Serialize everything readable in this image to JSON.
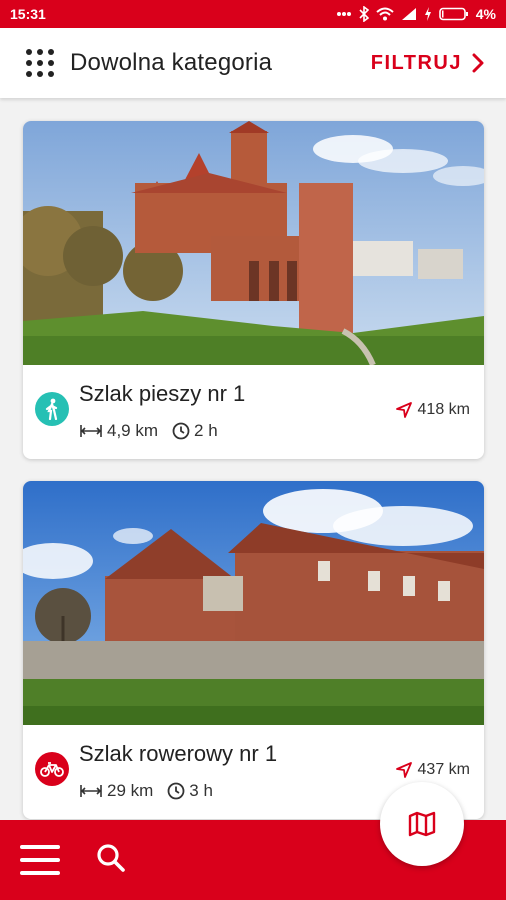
{
  "status_bar": {
    "time": "15:31",
    "battery": "4%"
  },
  "app_bar": {
    "title": "Dowolna kategoria",
    "filter_label": "FILTRUJ"
  },
  "routes": [
    {
      "title": "Szlak pieszy nr 1",
      "length": "4,9 km",
      "duration": "2 h",
      "distance": "418 km",
      "type_icon": "hiking-icon",
      "icon_color": "#26c0b4"
    },
    {
      "title": "Szlak rowerowy nr 1",
      "length": "29 km",
      "duration": "3 h",
      "distance": "437 km",
      "type_icon": "bicycle-icon",
      "icon_color": "#d9001b"
    }
  ],
  "colors": {
    "brand": "#d9001b",
    "hike": "#26c0b4"
  },
  "bottom_bar": {
    "menu_icon": "menu-icon",
    "search_icon": "search-icon",
    "map_icon": "map-icon"
  }
}
